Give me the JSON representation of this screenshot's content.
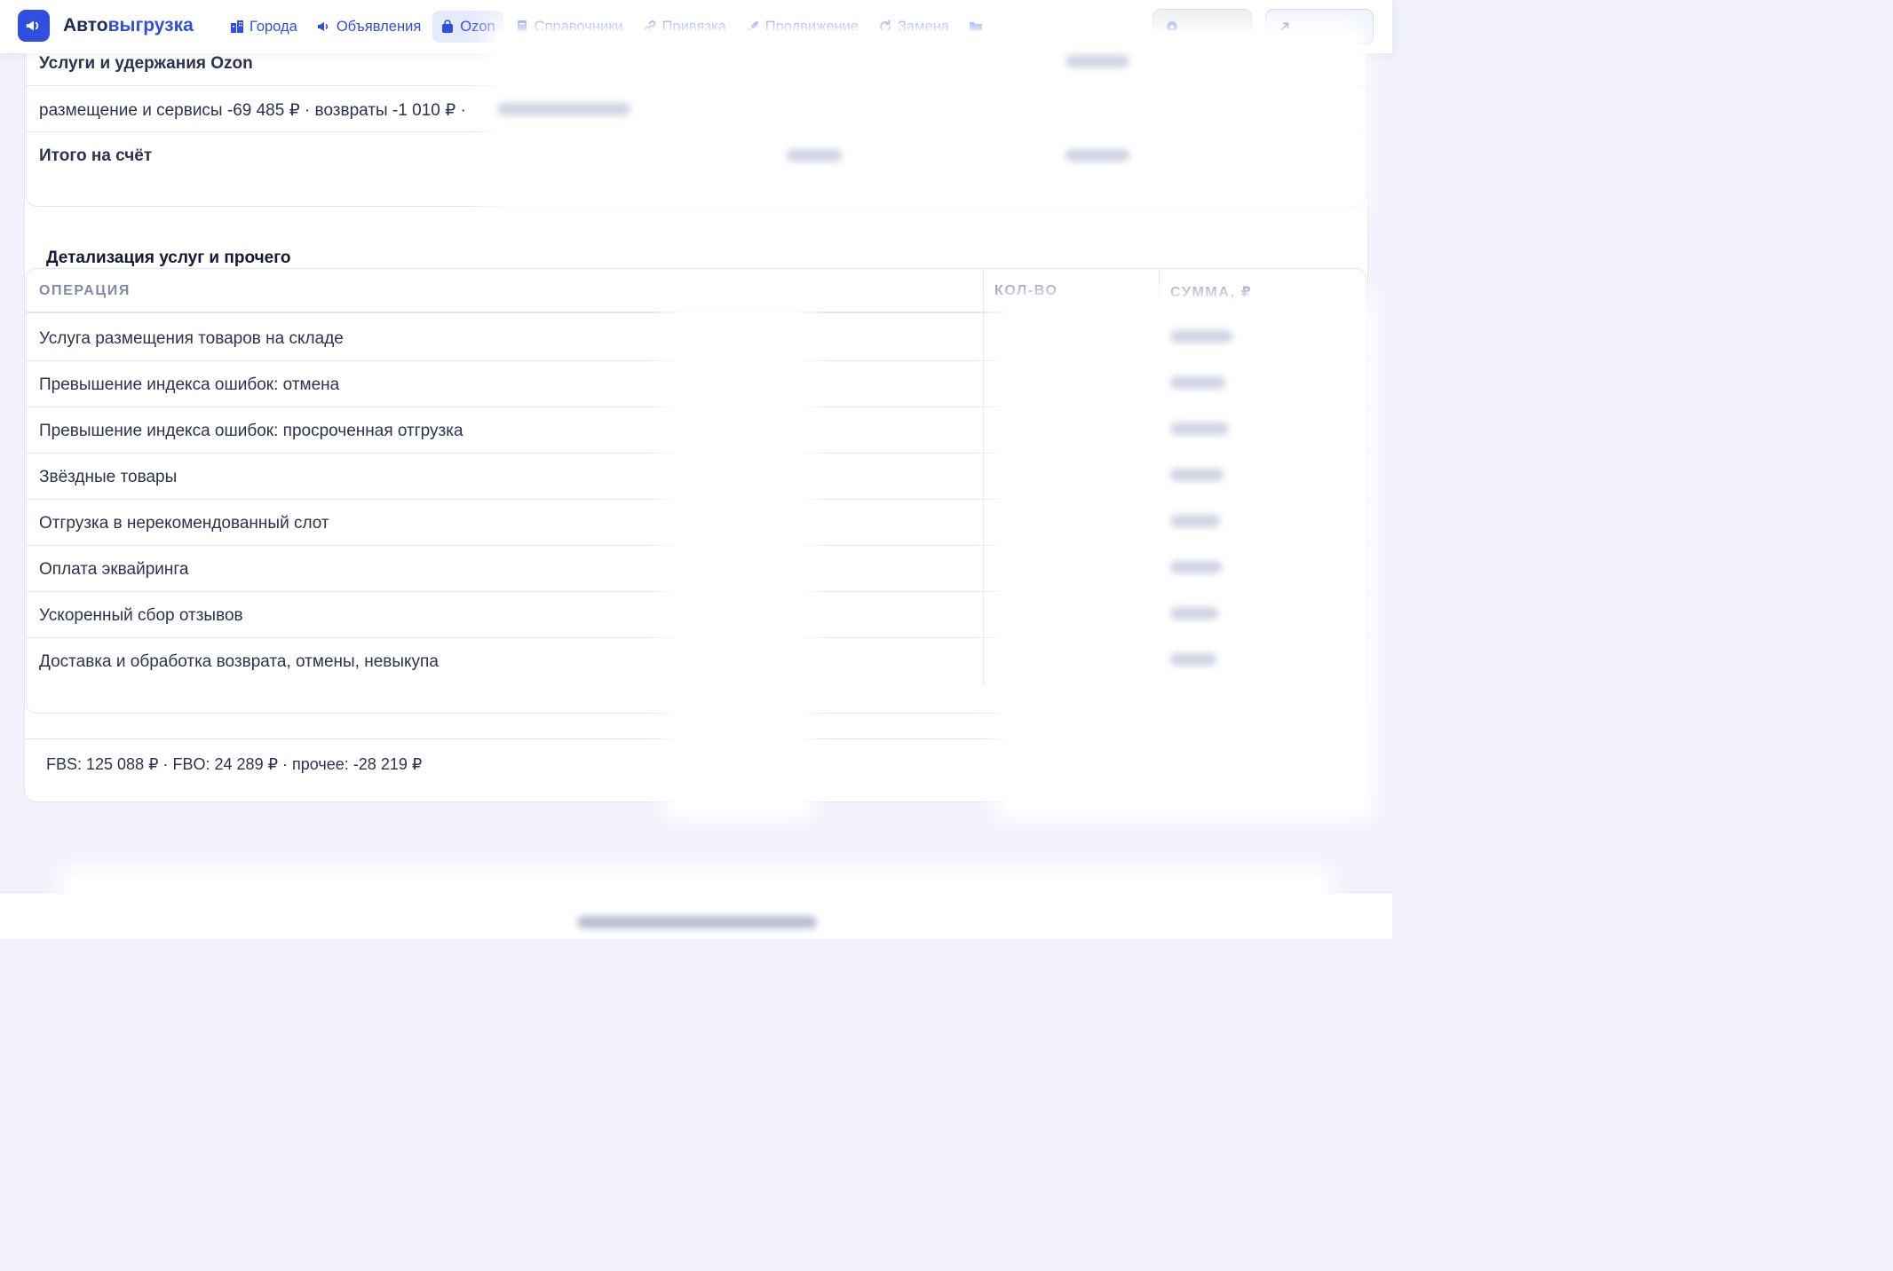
{
  "brand": {
    "name_part1": "Авто",
    "name_part2": "выгрузка",
    "accent_color": "#2f4fe0"
  },
  "nav": [
    {
      "label": "Города",
      "icon": "city-icon"
    },
    {
      "label": "Объявления",
      "icon": "megaphone-icon"
    },
    {
      "label": "Ozon",
      "icon": "bag-icon",
      "active": true
    },
    {
      "label": "Справочники",
      "icon": "book-icon"
    },
    {
      "label": "Привязка",
      "icon": "link-icon"
    },
    {
      "label": "Продвижение",
      "icon": "rocket-icon"
    },
    {
      "label": "Замена",
      "icon": "refresh-icon"
    },
    {
      "label": "",
      "icon": "folder-icon"
    }
  ],
  "theme_button": {
    "label": "",
    "icon": "gear-icon"
  },
  "mode_button": {
    "label": "",
    "icon": "arrow-up-right-icon"
  },
  "summary": {
    "services_title": "Услуги и удержания Ozon",
    "services_breakdown": "размещение и сервисы -69 485 ₽ · возвраты -1 010 ₽ ·",
    "total_label": "Итого на счёт"
  },
  "details": {
    "title": "Детализация услуг и прочего",
    "columns": [
      "ОПЕРАЦИЯ",
      "КОЛ-ВО",
      "СУММА, ₽"
    ],
    "rows": [
      {
        "name": "Услуга размещения товаров на складе",
        "qty": "",
        "sum": ""
      },
      {
        "name": "Превышение индекса ошибок: отмена",
        "qty": "",
        "sum": ""
      },
      {
        "name": "Превышение индекса ошибок: просроченная отгрузка",
        "qty": "",
        "sum": ""
      },
      {
        "name": "Звёздные товары",
        "qty": "",
        "sum": ""
      },
      {
        "name": "Отгрузка в нерекомендованный слот",
        "qty": "",
        "sum": ""
      },
      {
        "name": "Оплата эквайринга",
        "qty": "",
        "sum": ""
      },
      {
        "name": "Ускоренный сбор отзывов",
        "qty": "",
        "sum": ""
      },
      {
        "name": "Доставка и обработка возврата, отмены, невыкупа",
        "qty": "",
        "sum": ""
      }
    ]
  },
  "totals_line": "FBS: 125 088 ₽ · FBO: 24 289 ₽ · прочее: -28 219 ₽",
  "footer": {
    "text": ""
  }
}
